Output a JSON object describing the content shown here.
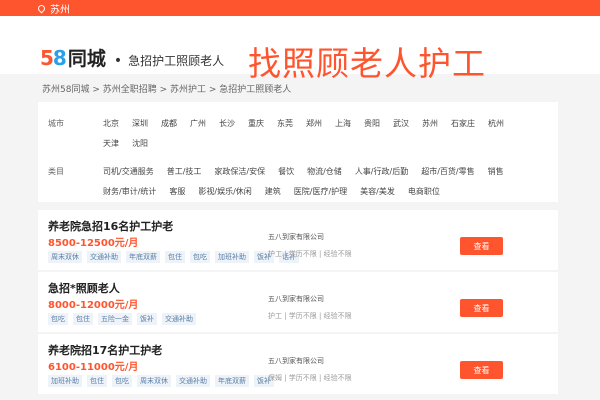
{
  "topbar": {
    "city": "苏州"
  },
  "header": {
    "logo_num_5": "5",
    "logo_num_8": "8",
    "logo_text": "同城",
    "logo_dot": "•",
    "logo_sub": "急招护工照顾老人",
    "big_title": "找照顾老人护工"
  },
  "breadcrumb": "苏州58同城 > 苏州全职招聘 > 苏州护工 > 急招护工照顾老人",
  "filters": {
    "city_label": "城市",
    "cities": [
      "北京",
      "深圳",
      "成都",
      "广州",
      "长沙",
      "重庆",
      "东莞",
      "郑州",
      "上海",
      "贵阳",
      "武汉",
      "苏州",
      "石家庄",
      "杭州",
      "天津",
      "沈阳"
    ],
    "category_label": "类目",
    "categories": [
      "司机/交通服务",
      "普工/技工",
      "家政保洁/安保",
      "餐饮",
      "物流/仓储",
      "人事/行政/后勤",
      "超市/百货/零售",
      "销售",
      "财务/审计/统计",
      "客服",
      "影视/娱乐/休闲",
      "建筑",
      "医院/医疗/护理",
      "美容/美发",
      "电商职位"
    ]
  },
  "jobs": [
    {
      "title": "养老院急招16名护工护老",
      "salary": "8500-12500元/月",
      "tags": [
        "周末双休",
        "交通补助",
        "年底双薪",
        "包住",
        "包吃",
        "加班补助",
        "饭补",
        "话补"
      ],
      "company": "五八到家有限公司",
      "req": "护工 | 学历不限 | 经验不限",
      "button": "查看"
    },
    {
      "title": "急招*照顾老人",
      "salary": "8000-12000元/月",
      "tags": [
        "包吃",
        "包住",
        "五险一金",
        "饭补",
        "交通补助"
      ],
      "company": "五八到家有限公司",
      "req": "护工 | 学历不限 | 经验不限",
      "button": "查看"
    },
    {
      "title": "养老院招17名护工护老",
      "salary": "6100-11000元/月",
      "tags": [
        "加班补助",
        "包住",
        "包吃",
        "周末双休",
        "交通补助",
        "年底双薪",
        "饭补"
      ],
      "company": "五八到家有限公司",
      "req": "保姆 | 学历不限 | 经验不限",
      "button": "查看"
    }
  ]
}
